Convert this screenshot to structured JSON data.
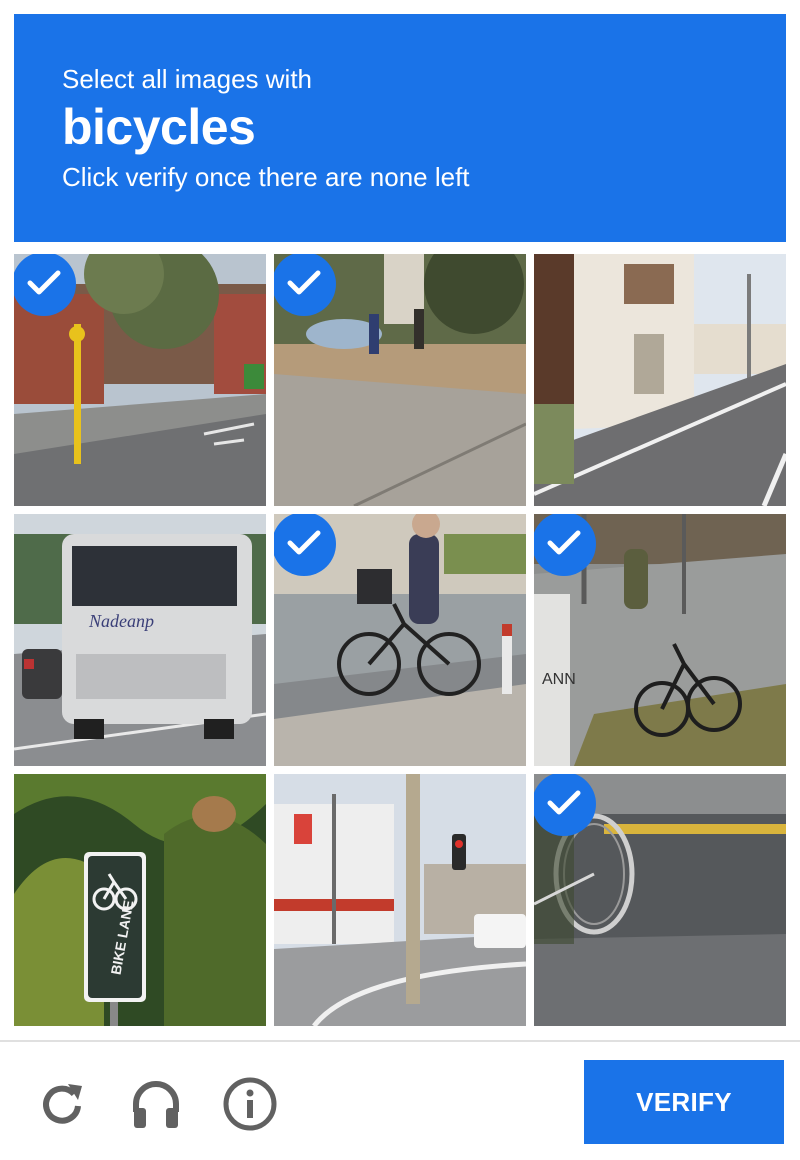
{
  "challenge": {
    "instruction": "Select all images with",
    "keyword": "bicycles",
    "subinstruction": "Click verify once there are none left"
  },
  "tiles": [
    {
      "index": 1,
      "scene": "street corner with yellow bollard and bike lane marking",
      "selected": true
    },
    {
      "index": 2,
      "scene": "dirt yard with sacks and people",
      "selected": true
    },
    {
      "index": 3,
      "scene": "white house beside road",
      "selected": false
    },
    {
      "index": 4,
      "scene": "white coach bus on road",
      "selected": false
    },
    {
      "index": 5,
      "scene": "person riding bicycle with basket",
      "selected": true
    },
    {
      "index": 6,
      "scene": "parked bicycle near sign",
      "selected": true
    },
    {
      "index": 7,
      "scene": "bike lane sign among plants",
      "selected": false
    },
    {
      "index": 8,
      "scene": "intersection with traffic light and utility pole",
      "selected": false
    },
    {
      "index": 9,
      "scene": "bicycle wheel on asphalt",
      "selected": true
    }
  ],
  "footer": {
    "reload_icon": "reload-icon",
    "audio_icon": "headphones-icon",
    "info_icon": "info-icon",
    "verify_label": "VERIFY"
  },
  "colors": {
    "accent": "#1a73e8",
    "icon_gray": "#616161"
  }
}
